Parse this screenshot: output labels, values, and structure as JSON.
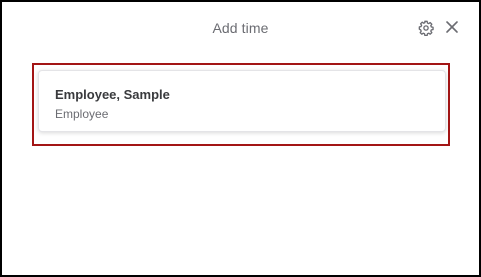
{
  "dialog": {
    "title": "Add time",
    "icons": {
      "settings": "gear-icon",
      "close": "close-icon"
    }
  },
  "employees": [
    {
      "name": "Employee, Sample",
      "role": "Employee"
    }
  ],
  "colors": {
    "highlight_border": "#a31515",
    "title_text": "#6b6c72",
    "name_text": "#393a3d"
  }
}
